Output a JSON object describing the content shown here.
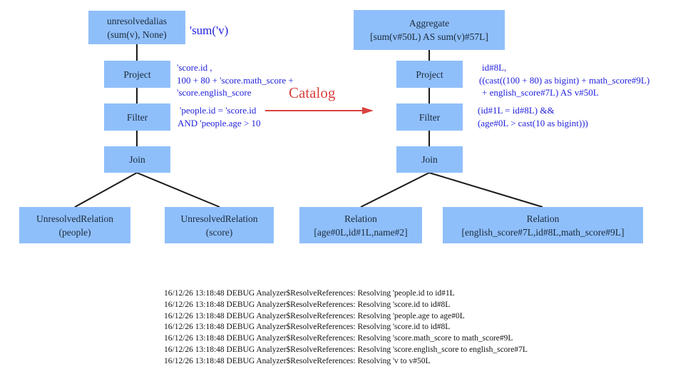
{
  "colors": {
    "node_fill": "#8fbffb",
    "annotation": "#2222dd",
    "catalog_arrow": "#d9423f",
    "edge": "#1a1a1a"
  },
  "unresolved_plan": {
    "root": {
      "line1": "unresolvedalias",
      "line2": "(sum(v), None)",
      "annotation": "'sum('v)"
    },
    "project": {
      "label": "Project",
      "annotation": [
        "'score.id ,",
        "100 + 80 + 'score.math_score +",
        "'score.english_score"
      ]
    },
    "filter": {
      "label": "Filter",
      "annotation": [
        "'people.id = 'score.id",
        "AND 'people.age > 10"
      ]
    },
    "join": {
      "label": "Join"
    },
    "left_relation": {
      "line1": "UnresolvedRelation",
      "line2": "(people)"
    },
    "right_relation": {
      "line1": "UnresolvedRelation",
      "line2": "(score)"
    }
  },
  "catalog_label": "Catalog",
  "resolved_plan": {
    "root": {
      "line1": "Aggregate",
      "line2": "[sum(v#50L) AS sum(v)#57L]"
    },
    "project": {
      "label": "Project",
      "annotation": [
        "id#8L,",
        "((cast((100 + 80) as bigint) + math_score#9L)",
        "+ english_score#7L) AS v#50L"
      ]
    },
    "filter": {
      "label": "Filter",
      "annotation": [
        "(id#1L = id#8L) &&",
        "(age#0L > cast(10 as bigint)))"
      ]
    },
    "join": {
      "label": "Join"
    },
    "left_relation": {
      "line1": "Relation",
      "line2": "[age#0L,id#1L,name#2]"
    },
    "right_relation": {
      "line1": "Relation",
      "line2": "[english_score#7L,id#8L,math_score#9L]"
    }
  },
  "log_lines": [
    "16/12/26 13:18:48 DEBUG Analyzer$ResolveReferences: Resolving 'people.id to id#1L",
    "16/12/26 13:18:48 DEBUG Analyzer$ResolveReferences: Resolving 'score.id to id#8L",
    "16/12/26 13:18:48 DEBUG Analyzer$ResolveReferences: Resolving 'people.age to age#0L",
    "16/12/26 13:18:48 DEBUG Analyzer$ResolveReferences: Resolving 'score.id to id#8L",
    "16/12/26 13:18:48 DEBUG Analyzer$ResolveReferences: Resolving 'score.math_score to math_score#9L",
    "16/12/26 13:18:48 DEBUG Analyzer$ResolveReferences: Resolving 'score.english_score to english_score#7L",
    "16/12/26 13:18:48 DEBUG Analyzer$ResolveReferences: Resolving 'v to v#50L"
  ]
}
